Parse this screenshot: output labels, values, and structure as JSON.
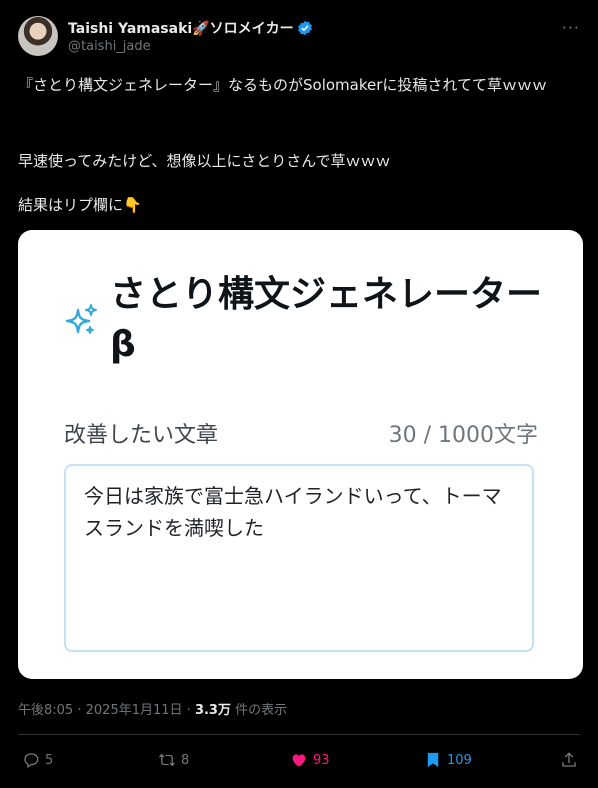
{
  "author": {
    "name": "Taishi Yamasaki🚀ソロメイカー",
    "handle": "@taishi_jade"
  },
  "tweet": {
    "line1": "『さとり構文ジェネレーター』なるものがSolomakerに投稿されてて草ｗｗｗ",
    "line2": "早速使ってみたけど、想像以上にさとりさんで草ｗｗｗ",
    "line3": "結果はリプ欄に👇"
  },
  "media": {
    "title": "さとり構文ジェネレーターβ",
    "field_label": "改善したい文章",
    "counter": "30 / 1000文字",
    "input_text": "今日は家族で富士急ハイランドいって、トーマスランドを満喫した"
  },
  "meta": {
    "time": "午後8:05",
    "sep": "·",
    "date": "2025年1月11日",
    "views_count": "3.3万",
    "views_label": "件の表示"
  },
  "actions": {
    "replies": "5",
    "retweets": "8",
    "likes": "93",
    "bookmarks": "109"
  },
  "colors": {
    "like": "#f91880",
    "bookmark": "#1d9bf0",
    "verified": "#1d9bf0",
    "sparkle": "#34a8d8"
  }
}
